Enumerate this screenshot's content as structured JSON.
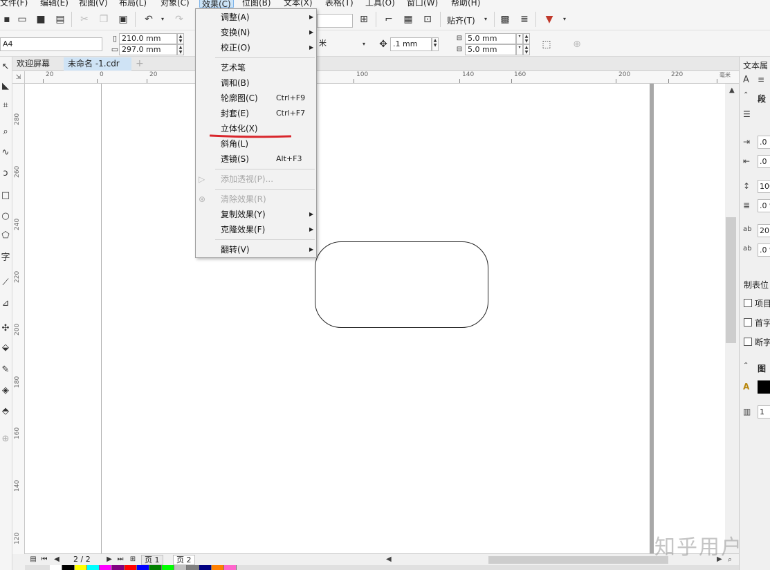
{
  "menubar": {
    "items": [
      "文件(F)",
      "编辑(E)",
      "视图(V)",
      "布局(L)",
      "对象(C)",
      "效果(C)",
      "位图(B)",
      "文本(X)",
      "表格(T)",
      "工具(O)",
      "窗口(W)",
      "帮助(H)"
    ],
    "active_index": 5
  },
  "toolbar1": {
    "snap_label": "贴齐(T)"
  },
  "toolbar2": {
    "paper_size": "A4",
    "width": "210.0 mm",
    "height": "297.0 mm",
    "units": "米",
    "nudge": ".1 mm",
    "dup_x": "5.0 mm",
    "dup_y": "5.0 mm"
  },
  "tabs": [
    {
      "label": "欢迎屏幕",
      "active": false
    },
    {
      "label": "未命名 -1.cdr",
      "active": true
    }
  ],
  "ruler": {
    "h_ticks": [
      "20",
      "0",
      "20",
      "100",
      "140",
      "160",
      "200",
      "220"
    ],
    "v_ticks": [
      "280",
      "260",
      "240",
      "220",
      "200",
      "180",
      "160",
      "140",
      "120"
    ],
    "unit_label": "毫米"
  },
  "dropdown": {
    "items": [
      {
        "label": "调整(A)",
        "submenu": true,
        "disabled": false
      },
      {
        "label": "变换(N)",
        "submenu": true,
        "disabled": false
      },
      {
        "label": "校正(O)",
        "submenu": true,
        "disabled": false
      },
      {
        "separator": true
      },
      {
        "label": "艺术笔",
        "disabled": false
      },
      {
        "label": "调和(B)",
        "disabled": false
      },
      {
        "label": "轮廓图(C)",
        "shortcut": "Ctrl+F9",
        "disabled": false
      },
      {
        "label": "封套(E)",
        "shortcut": "Ctrl+F7",
        "disabled": false
      },
      {
        "label": "立体化(X)",
        "disabled": false,
        "highlighted": true
      },
      {
        "label": "斜角(L)",
        "disabled": false
      },
      {
        "label": "透镜(S)",
        "shortcut": "Alt+F3",
        "disabled": false
      },
      {
        "separator": true
      },
      {
        "label": "添加透视(P)...",
        "disabled": true
      },
      {
        "separator": true
      },
      {
        "label": "清除效果(R)",
        "disabled": true
      },
      {
        "label": "复制效果(Y)",
        "submenu": true,
        "disabled": false
      },
      {
        "label": "克隆效果(F)",
        "submenu": true,
        "disabled": false
      },
      {
        "separator": true
      },
      {
        "label": "翻转(V)",
        "submenu": true,
        "disabled": false
      }
    ],
    "underline_color": "#d9262c"
  },
  "status": {
    "page_counter": "2 / 2",
    "pages": [
      "页 1",
      "页 2"
    ],
    "active_page": 1
  },
  "docker": {
    "title": "文本属",
    "section1": "段",
    "fields": [
      ".0 r",
      ".0 r",
      "100",
      ".0 %",
      "20.0",
      ".0 %"
    ],
    "tab_stop_label": "制表位",
    "checkboxes": [
      "项目",
      "首字",
      "断字"
    ],
    "section2": "图",
    "frame_field": "1"
  },
  "palette": {
    "colors": [
      "#ffffff",
      "#000000",
      "#ffff00",
      "#00ffff",
      "#ff00ff",
      "#800080",
      "#ff0000",
      "#0000ff",
      "#008000",
      "#00ff00",
      "#c0c0c0",
      "#808080",
      "#000080",
      "#ff8000",
      "#ff66cc"
    ]
  },
  "watermark": "知乎用户"
}
